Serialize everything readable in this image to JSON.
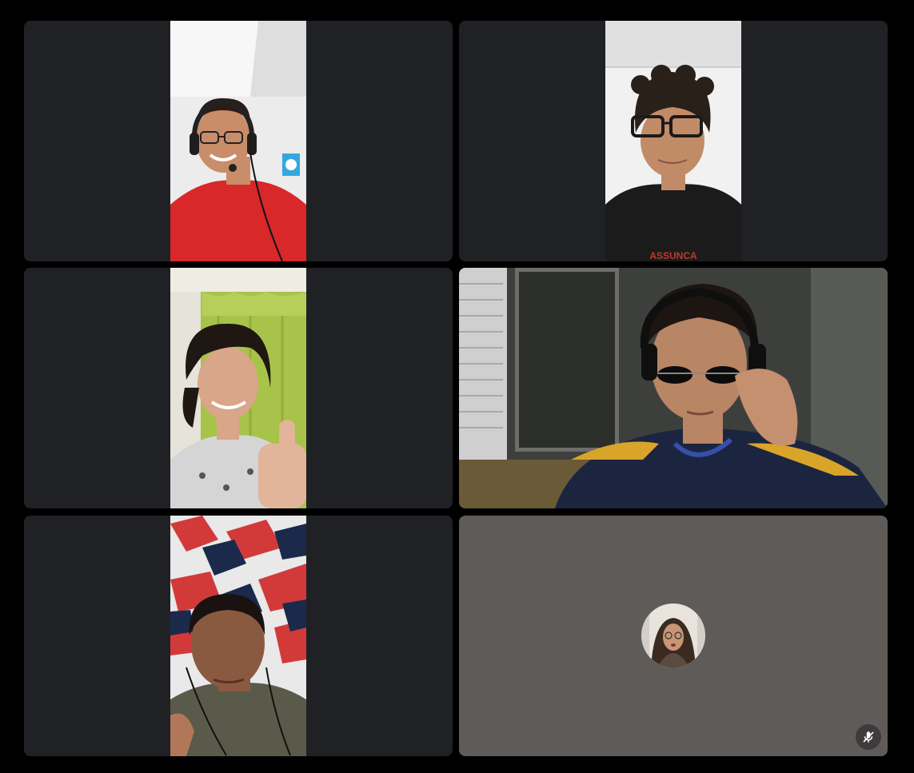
{
  "meeting": {
    "layout": "grid",
    "tiles": [
      {
        "kind": "video",
        "orientation": "portrait",
        "shirt_color": "#d8282a",
        "background_color": "#f1f1f1",
        "headset": true
      },
      {
        "kind": "video",
        "orientation": "portrait",
        "shirt_color": "#1a1a1a",
        "background_color": "#f2f2f2",
        "glasses": true
      },
      {
        "kind": "video",
        "orientation": "portrait",
        "shirt_color": "#d0d0d0",
        "background_color": "#a8c34a",
        "gesture": "thumbs-up"
      },
      {
        "kind": "video",
        "orientation": "landscape",
        "shirt_color": "#1c2540",
        "background_color": "#4b4d4a",
        "sunglasses": true,
        "headphones": true
      },
      {
        "kind": "video",
        "orientation": "portrait",
        "shirt_color": "#5a5a4a",
        "background_color": "#cf3f3f"
      },
      {
        "kind": "avatar",
        "orientation": "none",
        "background_color": "#5f5b59",
        "muted": true,
        "icon": "mic-off-icon"
      }
    ]
  }
}
